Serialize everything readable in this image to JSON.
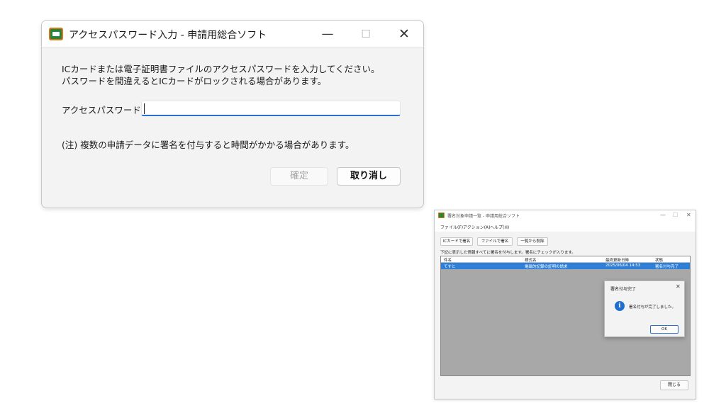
{
  "password_dialog": {
    "title": "アクセスパスワード入力 - 申請用総合ソフト",
    "window_controls": {
      "minimize": "—",
      "maximize": "☐",
      "close": "✕"
    },
    "message_line1": "ICカードまたは電子証明書ファイルのアクセスパスワードを入力してください。",
    "message_line2": "パスワードを間違えるとICカードがロックされる場合があります。",
    "password_label": "アクセスパスワード",
    "password_value": "",
    "note": "(注) 複数の申請データに署名を付与すると時間がかかる場合があります。",
    "ok_label": "確定",
    "cancel_label": "取り消し"
  },
  "signature_window": {
    "title": "署名対象申請一覧 - 申請用総合ソフト",
    "window_controls": {
      "minimize": "—",
      "maximize": "☐",
      "close": "✕"
    },
    "menu": [
      "ファイル(F)",
      "アクション(A)",
      "ヘルプ(H)"
    ],
    "toolbar": [
      "ICカードで署名",
      "ファイルで署名",
      "一覧から削除"
    ],
    "instruction": "下記に表示した情報すべてに署名を付与します。署名にチェックが入ります。",
    "columns": [
      "件名",
      "様式名",
      "最終更新日時",
      "状態"
    ],
    "rows": [
      {
        "subject": "てすと",
        "form": "電磁的記録の証明の請求",
        "updated": "2025/06/04 14:53",
        "status": "署名付与完了"
      }
    ],
    "close_label": "閉じる"
  },
  "completion_popup": {
    "title": "署名付与完了",
    "close": "✕",
    "info_icon": "i",
    "message": "署名付与が完了しました。",
    "ok_label": "OK"
  },
  "colors": {
    "accent": "#2d6fce",
    "selected_row": "#2f7fd8",
    "icon_green": "#1f8a3b",
    "icon_orange": "#e0731a"
  }
}
